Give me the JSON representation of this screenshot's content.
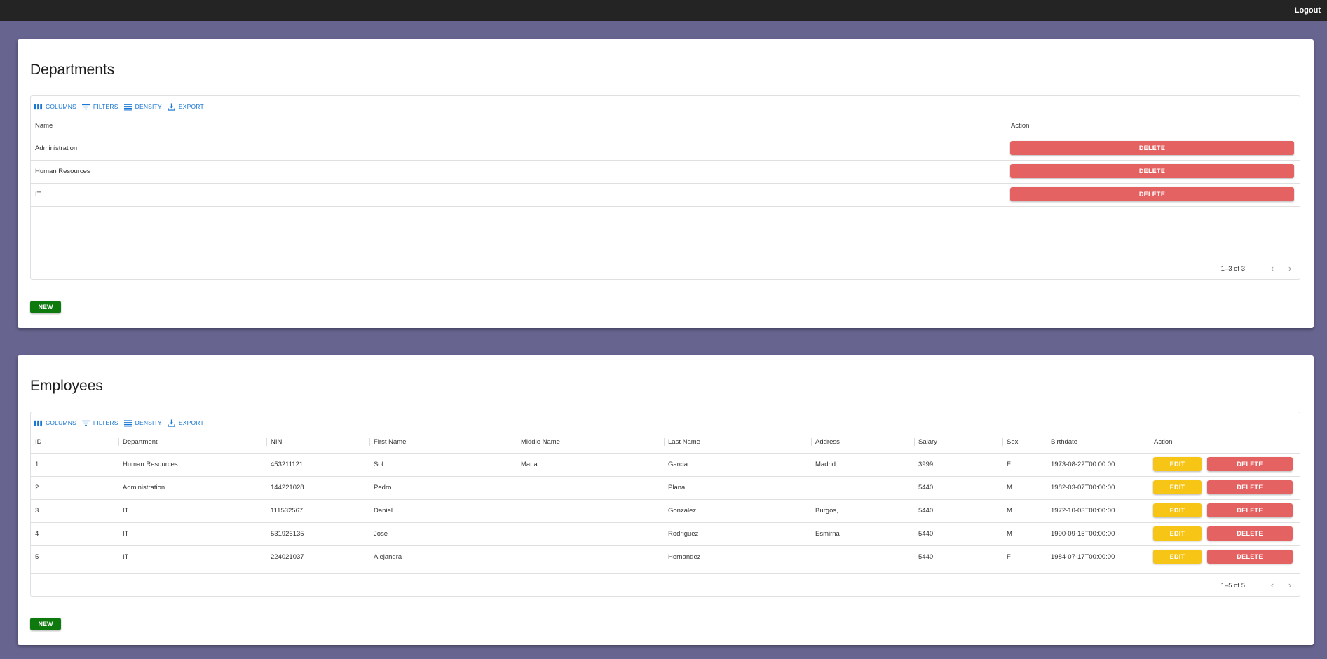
{
  "topbar": {
    "logout_label": "Logout"
  },
  "toolbar": {
    "columns_label": "COLUMNS",
    "filters_label": "FILTERS",
    "density_label": "DENSITY",
    "export_label": "EXPORT"
  },
  "departments": {
    "title": "Departments",
    "columns": [
      "Name",
      "Action"
    ],
    "rows": [
      {
        "name": "Administration"
      },
      {
        "name": "Human Resources"
      },
      {
        "name": "IT"
      }
    ],
    "delete_label": "DELETE",
    "pagination": "1–3 of 3",
    "new_label": "NEW"
  },
  "employees": {
    "title": "Employees",
    "columns": [
      "ID",
      "Department",
      "NIN",
      "First Name",
      "Middle Name",
      "Last Name",
      "Address",
      "Salary",
      "Sex",
      "Birthdate",
      "Action"
    ],
    "rows": [
      {
        "id": "1",
        "department": "Human Resources",
        "nin": "453211121",
        "first": "Sol",
        "middle": "Maria",
        "last": "Garcia",
        "address": "Madrid",
        "salary": "3999",
        "sex": "F",
        "birthdate": "1973-08-22T00:00:00"
      },
      {
        "id": "2",
        "department": "Administration",
        "nin": "144221028",
        "first": "Pedro",
        "middle": "",
        "last": "Plana",
        "address": "",
        "salary": "5440",
        "sex": "M",
        "birthdate": "1982-03-07T00:00:00"
      },
      {
        "id": "3",
        "department": "IT",
        "nin": "111532567",
        "first": "Daniel",
        "middle": "",
        "last": "Gonzalez",
        "address": "Burgos, ...",
        "salary": "5440",
        "sex": "M",
        "birthdate": "1972-10-03T00:00:00"
      },
      {
        "id": "4",
        "department": "IT",
        "nin": "531926135",
        "first": "Jose",
        "middle": "",
        "last": "Rodriguez",
        "address": "Esmirna",
        "salary": "5440",
        "sex": "M",
        "birthdate": "1990-09-15T00:00:00"
      },
      {
        "id": "5",
        "department": "IT",
        "nin": "224021037",
        "first": "Alejandra",
        "middle": "",
        "last": "Hernandez",
        "address": "",
        "salary": "5440",
        "sex": "F",
        "birthdate": "1984-07-17T00:00:00"
      }
    ],
    "edit_label": "EDIT",
    "delete_label": "DELETE",
    "pagination": "1–5 of 5",
    "new_label": "NEW"
  },
  "pager": {
    "prev_icon": "chevron-left-icon",
    "next_icon": "chevron-right-icon"
  }
}
